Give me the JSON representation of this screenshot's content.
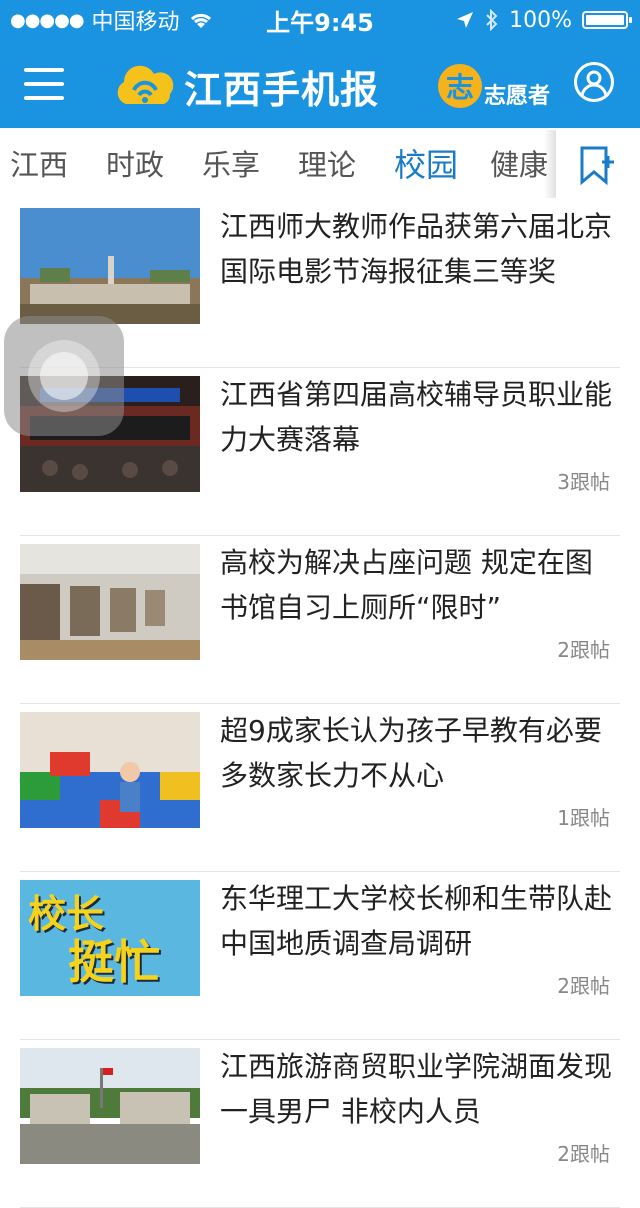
{
  "status_bar": {
    "carrier": "中国移动",
    "time": "上午9:45",
    "battery": "100%"
  },
  "header": {
    "logo_text": "江西手机报",
    "volunteer_badge": "志",
    "volunteer_label": "志愿者",
    "menu_icon": "hamburger-menu-icon",
    "user_icon": "user-circle-icon",
    "brand_color": "#1a93e0",
    "accent_color": "#f5b21b"
  },
  "tabs": [
    {
      "label": "江西",
      "active": false
    },
    {
      "label": "时政",
      "active": false
    },
    {
      "label": "乐享",
      "active": false
    },
    {
      "label": "理论",
      "active": false
    },
    {
      "label": "校园",
      "active": true
    },
    {
      "label": "健康",
      "active": false
    }
  ],
  "tab_add_icon": "bookmark-add-icon",
  "articles": [
    {
      "title": "江西师大教师作品获第六届北京国际电影节海报征集三等奖",
      "replies": ""
    },
    {
      "title": "江西省第四届高校辅导员职业能力大赛落幕",
      "replies": "3跟帖"
    },
    {
      "title": "高校为解决占座问题 规定在图书馆自习上厕所“限时”",
      "replies": "2跟帖"
    },
    {
      "title": "超9成家长认为孩子早教有必要 多数家长力不从心",
      "replies": "1跟帖"
    },
    {
      "title": "东华理工大学校长柳和生带队赴中国地质调查局调研",
      "replies": "2跟帖"
    },
    {
      "title": "江西旅游商贸职业学院湖面发现一具男尸 非校内人员",
      "replies": "2跟帖"
    }
  ],
  "thumb5_text": {
    "line1": "校长",
    "line2": "挺忙"
  }
}
